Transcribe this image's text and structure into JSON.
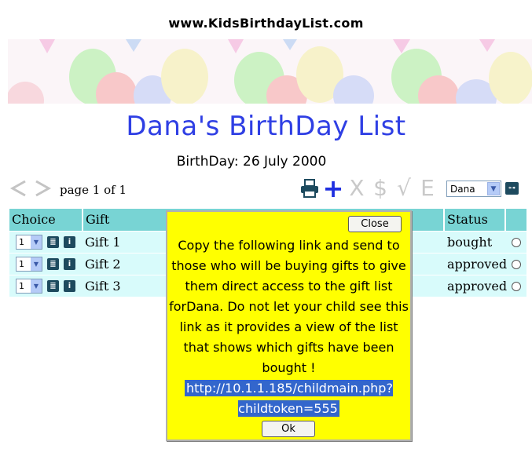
{
  "site": {
    "url": "www.KidsBirthdayList.com"
  },
  "page": {
    "title": "Dana's BirthDay List",
    "birthday": "BirthDay: 26 July 2000"
  },
  "pager": {
    "text": "page 1 of 1",
    "prev_icon": "chevron-left-icon",
    "next_icon": "chevron-right-icon"
  },
  "toolbar": {
    "print_icon": "printer-icon",
    "add_icon": "plus-icon",
    "add_symbol": "+",
    "delete_symbol": "X",
    "price_symbol": "$",
    "approve_symbol": "√",
    "edit_symbol": "E",
    "active_color": "#1f2fe0",
    "disabled_color": "#c9c9c9"
  },
  "child_select": {
    "selected": "Dana"
  },
  "table": {
    "headers": {
      "choice": "Choice",
      "gift": "Gift",
      "status": "Status"
    },
    "rows": [
      {
        "qty": "1",
        "gift": "Gift 1",
        "status": "bought"
      },
      {
        "qty": "1",
        "gift": "Gift 2",
        "status": "approved"
      },
      {
        "qty": "1",
        "gift": "Gift 3",
        "status": "approved"
      }
    ],
    "header_color": "#78d4d4",
    "row_color": "#d8fbfb"
  },
  "modal": {
    "close_label": "Close",
    "message": "Copy the following link and send to those who will be buying gifts to give them direct access to the gift list forDana. Do not let your child see this link as it provides a view of the list that shows which gifts have been bought !",
    "link": "http://10.1.1.185/childmain.php?childtoken=555",
    "ok_label": "Ok",
    "background": "#ffff00"
  }
}
